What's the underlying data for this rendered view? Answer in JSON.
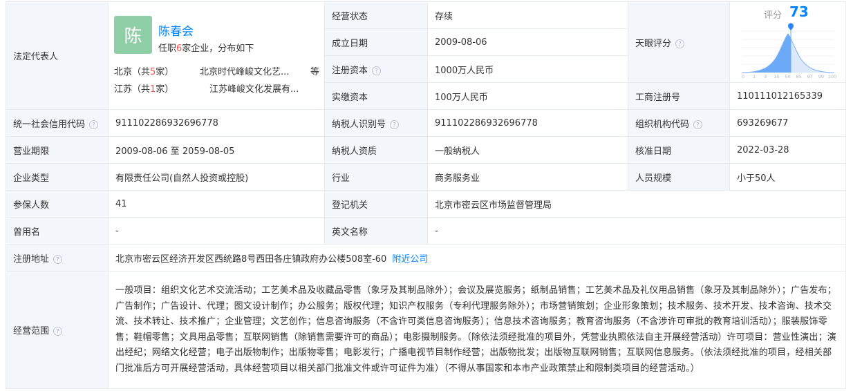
{
  "rows": {
    "legal_rep_label": "法定代表人",
    "legal_rep": {
      "avatar_char": "陈",
      "name": "陈春会",
      "desc_prefix": "任职",
      "desc_count": "6",
      "desc_suffix": "家企业，分布如下",
      "provinces": [
        {
          "name_prefix": "北京（共",
          "count": "5",
          "name_suffix": "家）",
          "company": "北京时代峰峻文化艺..."
        },
        {
          "name_prefix": "江苏（共",
          "count": "1",
          "name_suffix": "家）",
          "company": "江苏峰峻文化发展有..."
        }
      ],
      "more": "等"
    },
    "status_label": "经营状态",
    "status": "存续",
    "found_date_label": "成立日期",
    "found_date": "2009-08-06",
    "reg_capital_label": "注册资本",
    "reg_capital": "1000万人民币",
    "paid_capital_label": "实缴资本",
    "paid_capital": "100万人民币",
    "tianyan_label": "天眼评分",
    "score": {
      "label": "评分",
      "value": "73",
      "ticks": [
        "0",
        "1",
        "3",
        "15",
        "50",
        "85",
        "97",
        "99",
        "100"
      ]
    },
    "biz_reg_no_label": "工商注册号",
    "biz_reg_no": "110111012165339",
    "credit_code_label": "统一社会信用代码",
    "credit_code": "911102286932696778",
    "taxpayer_id_label": "纳税人识别号",
    "taxpayer_id": "911102286932696778",
    "org_code_label": "组织机构代码",
    "org_code": "693269677",
    "period_label": "营业期限",
    "period": "2009-08-06 至 2059-08-05",
    "taxpayer_qual_label": "纳税人资质",
    "taxpayer_qual": "一般纳税人",
    "approve_date_label": "核准日期",
    "approve_date": "2022-03-28",
    "company_type_label": "企业类型",
    "company_type": "有限责任公司(自然人投资或控股)",
    "industry_label": "行业",
    "industry": "商务服务业",
    "staff_label": "人员规模",
    "staff": "小于50人",
    "insured_label": "参保人数",
    "insured": "41",
    "reg_authority_label": "登记机关",
    "reg_authority": "北京市密云区市场监督管理局",
    "former_name_label": "曾用名",
    "former_name": "-",
    "en_name_label": "英文名称",
    "en_name": "-",
    "address_label": "注册地址",
    "address": "北京市密云区经济开发区西统路8号西田各庄镇政府办公楼508室-60",
    "nearby_link": "附近公司",
    "scope_label": "经营范围",
    "scope": "一般项目：组织文化艺术交流活动；工艺美术品及收藏品零售（象牙及其制品除外）；会议及展览服务；纸制品销售；工艺美术品及礼仪用品销售（象牙及其制品除外）；广告发布；广告制作；广告设计、代理；图文设计制作；办公服务；版权代理；知识产权服务（专利代理服务除外）；市场营销策划；企业形象策划；技术服务、技术开发、技术咨询、技术交流、技术转让、技术推广；企业管理；文艺创作；信息咨询服务（不含许可类信息咨询服务）；信息技术咨询服务；教育咨询服务（不含涉许可审批的教育培训活动）；服装服饰零售；鞋帽零售；文具用品零售；互联网销售（除销售需要许可的商品）；电影摄制服务。（除依法须经批准的项目外，凭营业执照依法自主开展经营活动）许可项目：营业性演出；演出经纪；网络文化经营；电子出版物制作；出版物零售；电影发行；广播电视节目制作经营；出版物批发；出版物互联网销售；互联网信息服务。（依法须经批准的项目，经相关部门批准后方可开展经营活动，具体经营项目以相关部门批准文件或许可证件为准）（不得从事国家和本市产业政策禁止和限制类项目的经营活动。）"
  },
  "colors": {
    "accent": "#0084ff",
    "label_bg": "#f3f7fc",
    "border": "#e6ebf0",
    "highlight": "#ff4d4f",
    "avatar_bg": "#8fcfa7"
  },
  "icons": {
    "help": "question-circle-icon",
    "score_marker": "location-pin-icon"
  }
}
